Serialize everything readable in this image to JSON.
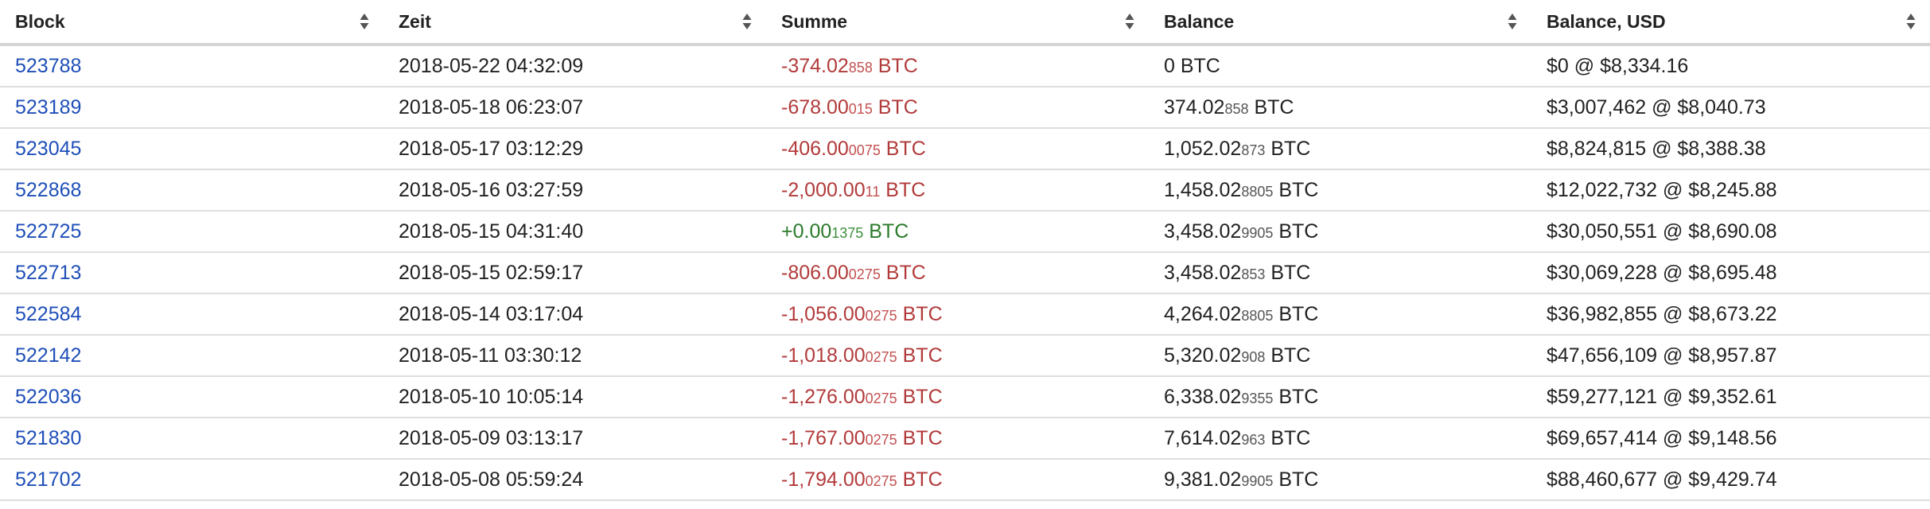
{
  "colors": {
    "link": "#1f4fb8",
    "negative": "#b23a3a",
    "positive": "#2b7a2b",
    "text": "#222222"
  },
  "header": {
    "block": "Block",
    "zeit": "Zeit",
    "summe": "Summe",
    "balance": "Balance",
    "balance_usd": "Balance, USD",
    "sort_icon": "sort-icon"
  },
  "rows": [
    {
      "block": "523788",
      "zeit": "2018-05-22 04:32:09",
      "sum_sign": "negative",
      "sum_main": "-374.02",
      "sum_small": "858",
      "sum_unit": " BTC",
      "bal_main": "0",
      "bal_small": "",
      "bal_unit": " BTC",
      "usd": "$0 @ $8,334.16"
    },
    {
      "block": "523189",
      "zeit": "2018-05-18 06:23:07",
      "sum_sign": "negative",
      "sum_main": "-678.00",
      "sum_small": "015",
      "sum_unit": " BTC",
      "bal_main": "374.02",
      "bal_small": "858",
      "bal_unit": " BTC",
      "usd": "$3,007,462 @ $8,040.73"
    },
    {
      "block": "523045",
      "zeit": "2018-05-17 03:12:29",
      "sum_sign": "negative",
      "sum_main": "-406.00",
      "sum_small": "0075",
      "sum_unit": " BTC",
      "bal_main": "1,052.02",
      "bal_small": "873",
      "bal_unit": " BTC",
      "usd": "$8,824,815 @ $8,388.38"
    },
    {
      "block": "522868",
      "zeit": "2018-05-16 03:27:59",
      "sum_sign": "negative",
      "sum_main": "-2,000.00",
      "sum_small": "11",
      "sum_unit": " BTC",
      "bal_main": "1,458.02",
      "bal_small": "8805",
      "bal_unit": " BTC",
      "usd": "$12,022,732 @ $8,245.88"
    },
    {
      "block": "522725",
      "zeit": "2018-05-15 04:31:40",
      "sum_sign": "positive",
      "sum_main": "+0.00",
      "sum_small": "1375",
      "sum_unit": " BTC",
      "bal_main": "3,458.02",
      "bal_small": "9905",
      "bal_unit": " BTC",
      "usd": "$30,050,551 @ $8,690.08"
    },
    {
      "block": "522713",
      "zeit": "2018-05-15 02:59:17",
      "sum_sign": "negative",
      "sum_main": "-806.00",
      "sum_small": "0275",
      "sum_unit": " BTC",
      "bal_main": "3,458.02",
      "bal_small": "853",
      "bal_unit": " BTC",
      "usd": "$30,069,228 @ $8,695.48"
    },
    {
      "block": "522584",
      "zeit": "2018-05-14 03:17:04",
      "sum_sign": "negative",
      "sum_main": "-1,056.00",
      "sum_small": "0275",
      "sum_unit": " BTC",
      "bal_main": "4,264.02",
      "bal_small": "8805",
      "bal_unit": " BTC",
      "usd": "$36,982,855 @ $8,673.22"
    },
    {
      "block": "522142",
      "zeit": "2018-05-11 03:30:12",
      "sum_sign": "negative",
      "sum_main": "-1,018.00",
      "sum_small": "0275",
      "sum_unit": " BTC",
      "bal_main": "5,320.02",
      "bal_small": "908",
      "bal_unit": " BTC",
      "usd": "$47,656,109 @ $8,957.87"
    },
    {
      "block": "522036",
      "zeit": "2018-05-10 10:05:14",
      "sum_sign": "negative",
      "sum_main": "-1,276.00",
      "sum_small": "0275",
      "sum_unit": " BTC",
      "bal_main": "6,338.02",
      "bal_small": "9355",
      "bal_unit": " BTC",
      "usd": "$59,277,121 @ $9,352.61"
    },
    {
      "block": "521830",
      "zeit": "2018-05-09 03:13:17",
      "sum_sign": "negative",
      "sum_main": "-1,767.00",
      "sum_small": "0275",
      "sum_unit": " BTC",
      "bal_main": "7,614.02",
      "bal_small": "963",
      "bal_unit": " BTC",
      "usd": "$69,657,414 @ $9,148.56"
    },
    {
      "block": "521702",
      "zeit": "2018-05-08 05:59:24",
      "sum_sign": "negative",
      "sum_main": "-1,794.00",
      "sum_small": "0275",
      "sum_unit": " BTC",
      "bal_main": "9,381.02",
      "bal_small": "9905",
      "bal_unit": " BTC",
      "usd": "$88,460,677 @ $9,429.74"
    }
  ]
}
